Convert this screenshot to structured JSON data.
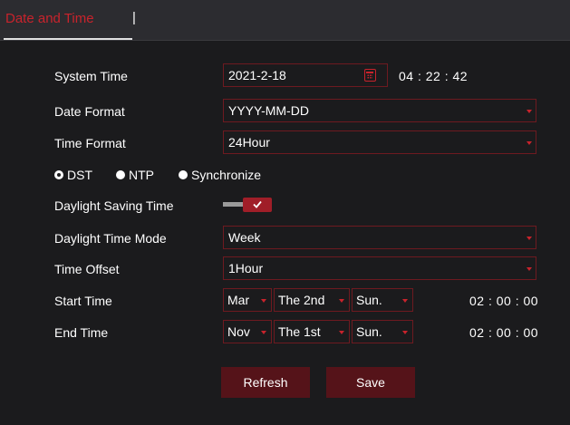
{
  "tab": {
    "title": "Date and Time",
    "separator": "|"
  },
  "system_time": {
    "label": "System Time",
    "date": "2021-2-18",
    "time": "04 : 22 : 42"
  },
  "date_format": {
    "label": "Date Format",
    "value": "YYYY-MM-DD"
  },
  "time_format": {
    "label": "Time Format",
    "value": "24Hour"
  },
  "modes": {
    "selected": "DST",
    "options": [
      "DST",
      "NTP",
      "Synchronize"
    ]
  },
  "dst_toggle": {
    "label": "Daylight Saving Time",
    "enabled": true
  },
  "dst_mode": {
    "label": "Daylight Time Mode",
    "value": "Week"
  },
  "time_offset": {
    "label": "Time Offset",
    "value": "1Hour"
  },
  "start_time": {
    "label": "Start Time",
    "month": "Mar",
    "week": "The 2nd",
    "day": "Sun.",
    "time": "02 : 00 : 00"
  },
  "end_time": {
    "label": "End Time",
    "month": "Nov",
    "week": "The 1st",
    "day": "Sun.",
    "time": "02 : 00 : 00"
  },
  "buttons": {
    "refresh": "Refresh",
    "save": "Save"
  },
  "colors": {
    "accent": "#c8232c",
    "button_bg": "#551319",
    "background": "#1b1b1d",
    "header_bg": "#2c2c30"
  }
}
